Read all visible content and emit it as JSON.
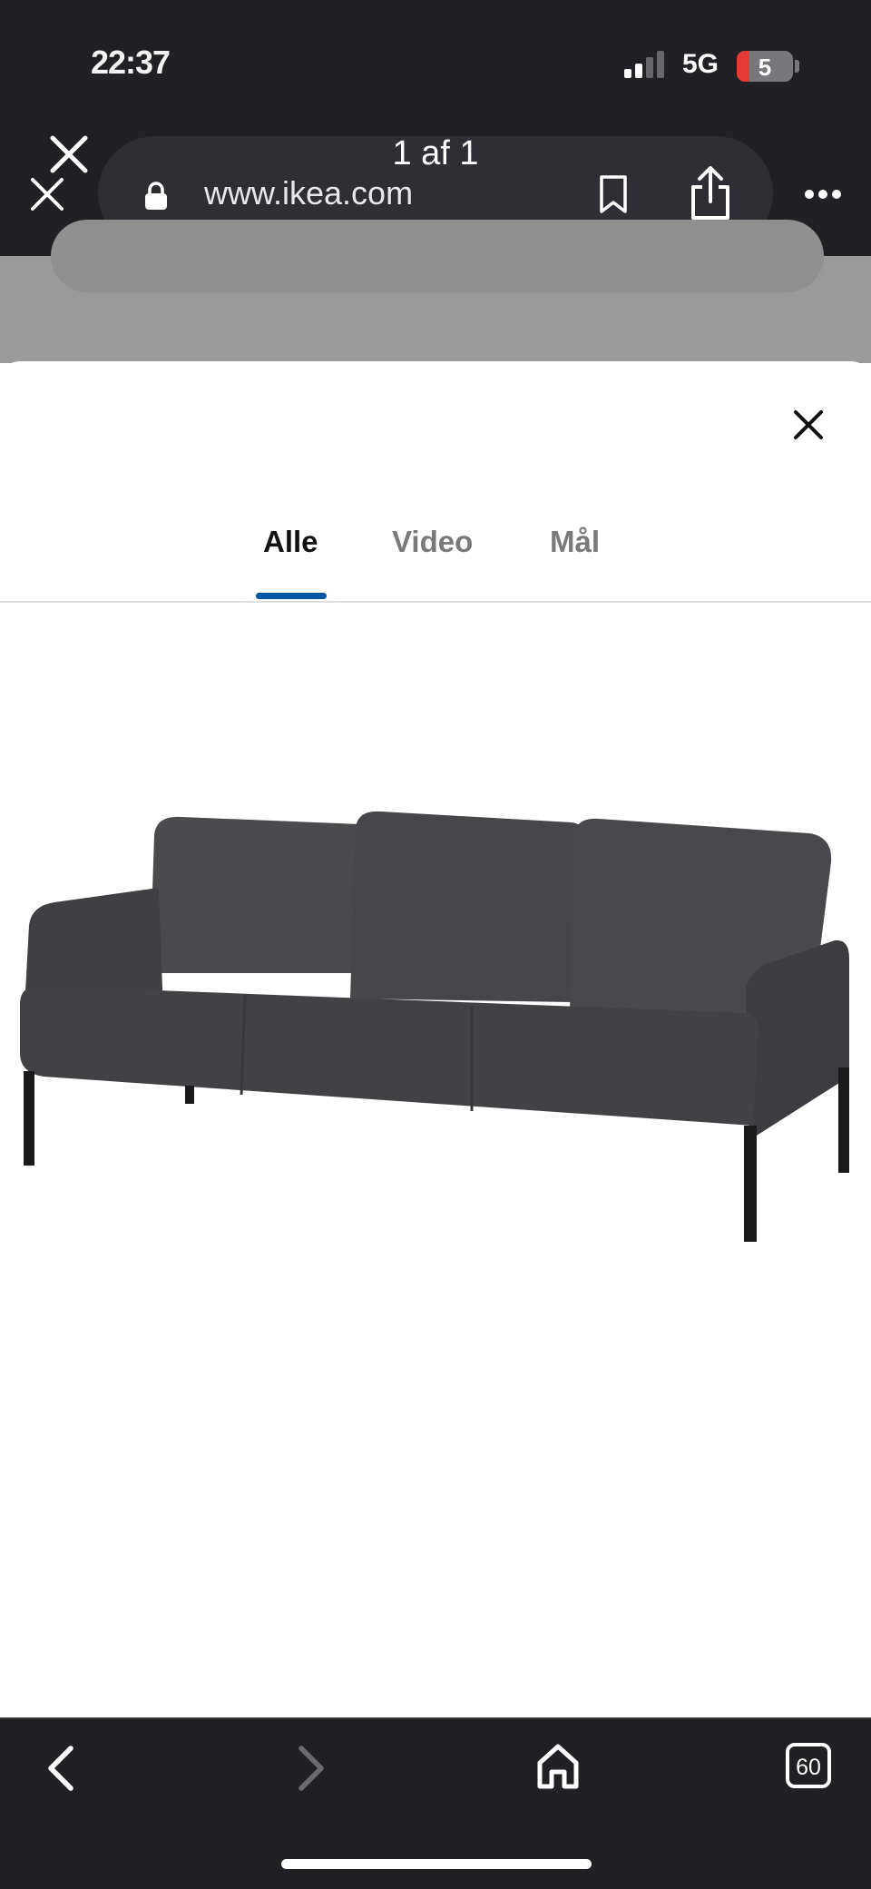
{
  "status_bar": {
    "time": "22:37",
    "network": "5G",
    "battery": "5"
  },
  "browser": {
    "page_counter": "1 af 1",
    "url": "www.ikea.com"
  },
  "viewer": {
    "tabs": [
      {
        "label": "Alle",
        "active": true
      },
      {
        "label": "Video",
        "active": false
      },
      {
        "label": "Mål",
        "active": false
      }
    ],
    "image": "dark-grey-three-seat-sofa"
  },
  "bottom_nav": {
    "tab_count": "60"
  },
  "colors": {
    "chrome": "#202125",
    "urlbar": "#2e2f34",
    "accent_underline": "#0058a3",
    "sofa_fabric": "#45464a"
  }
}
